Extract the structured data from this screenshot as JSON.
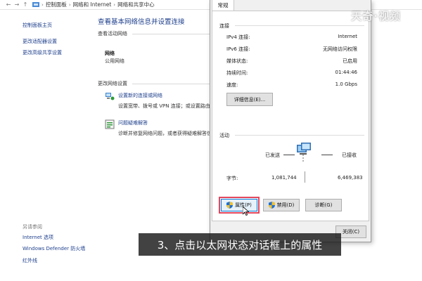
{
  "address_bar": {
    "crumbs": [
      "控制面板",
      "网络和 Internet",
      "网络和共享中心"
    ]
  },
  "left_pane": {
    "links": [
      "控制面板主页",
      "更改适配器设置",
      "更改高级共享设置"
    ],
    "see_also_label": "另请参阅",
    "see_also": [
      "Internet 选项",
      "Windows Defender 防火墙",
      "红外线"
    ]
  },
  "main": {
    "title": "查看基本网络信息并设置连接",
    "active_networks_label": "查看活动网络",
    "network_name": "网络",
    "network_type": "公用网络",
    "change_settings_label": "更改网络设置",
    "task1_link": "设置新的连接或网络",
    "task1_desc": "设置宽带、拨号或 VPN 连接；或设置路由",
    "task2_link": "问题疑难解答",
    "task2_desc": "诊断并修复网络问题，或者获得疑难解答信"
  },
  "dialog": {
    "tab_label": "常规",
    "connection_label": "连接",
    "rows": [
      {
        "key": "IPv4 连接:",
        "value": "Internet"
      },
      {
        "key": "IPv6 连接:",
        "value": "无网络访问权限"
      },
      {
        "key": "媒体状态:",
        "value": "已启用"
      },
      {
        "key": "持续时间:",
        "value": "01:44:46"
      },
      {
        "key": "速度:",
        "value": "1.0 Gbps"
      }
    ],
    "details_button": "详细信息(E)...",
    "activity_label": "活动",
    "sent_label": "已发送",
    "received_label": "已接收",
    "bytes_label": "字节:",
    "bytes_sent": "1,081,744",
    "bytes_received": "6,469,383",
    "properties_button": "属性(P)",
    "disable_button": "禁用(D)",
    "diagnose_button": "诊断(G)",
    "close_button": "关闭(C)"
  },
  "overlay": {
    "watermark": "天奇·视频",
    "caption": "3、点击以太网状态对话框上的属性"
  },
  "colors": {
    "link": "#1e3f8c",
    "highlight": "#e2465c",
    "shield_blue": "#1f6fd1",
    "shield_yellow": "#f2c230"
  }
}
